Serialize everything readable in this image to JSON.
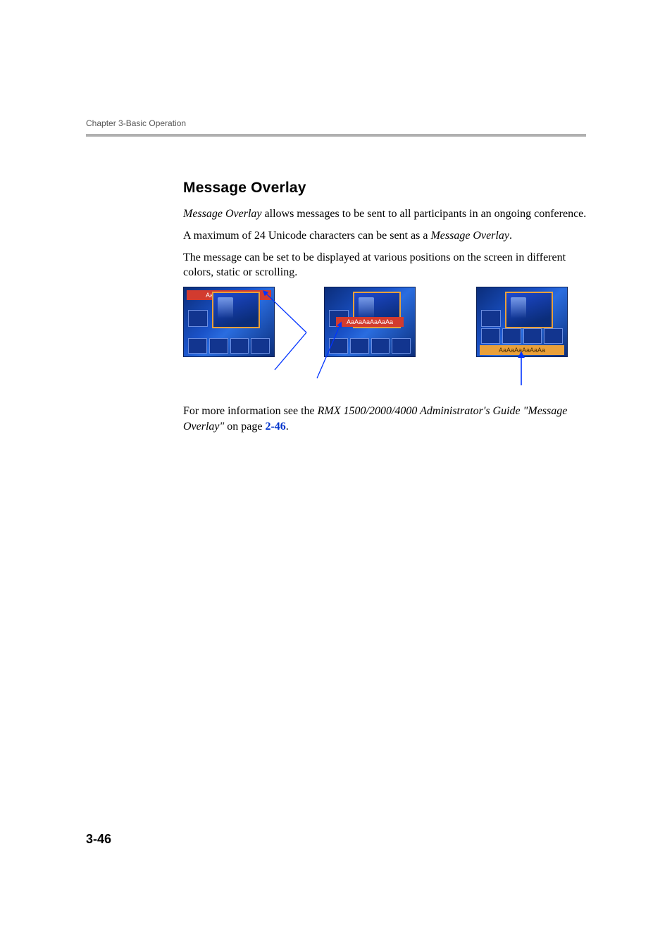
{
  "running_head": "Chapter 3-Basic Operation",
  "section": {
    "title": "Message Overlay",
    "p1_pre": "Message Overlay",
    "p1_rest": " allows messages to be sent to all participants in an ongoing conference.",
    "p2_pre": "A maximum of 24 Unicode characters can be sent as a ",
    "p2_italic": "Message Overlay",
    "p2_post": ".",
    "p3": "The message can be set to be displayed at various positions on the screen in different colors, static or scrolling.",
    "p4_pre": "For more information see the ",
    "p4_italic1": "RMX 1500/2000/4000 Administrator's Guide",
    "p4_mid": " ",
    "p4_italic2": "\"Message Overlay\"",
    "p4_post_pre_link": " on page ",
    "p4_link": "2-46",
    "p4_post": "."
  },
  "thumbs": {
    "t1_banner": "AaAaAaAaAaAa",
    "t2_banner": "AaAaAaAaAaAa",
    "t3_banner": "AaAaAaAaAaAa"
  },
  "page_number": "3-46"
}
